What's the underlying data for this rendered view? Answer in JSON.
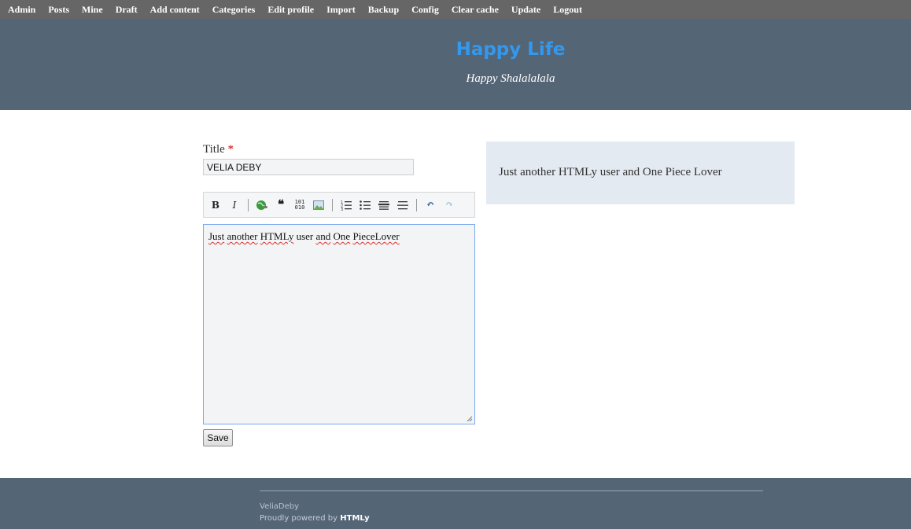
{
  "admin_bar": {
    "items": [
      "Admin",
      "Posts",
      "Mine",
      "Draft",
      "Add content",
      "Categories",
      "Edit profile",
      "Import",
      "Backup",
      "Config",
      "Clear cache",
      "Update",
      "Logout"
    ]
  },
  "header": {
    "site_title": "Happy Life",
    "tagline": "Happy Shalalalala",
    "background_color": "#546576",
    "title_color": "#3399ee"
  },
  "form": {
    "title_label": "Title",
    "required_marker": "*",
    "title_value": "VELIA DEBY",
    "editor_toolbar": [
      {
        "icon": "bold-icon",
        "glyph": "B"
      },
      {
        "icon": "italic-icon",
        "glyph": "I"
      },
      {
        "icon": "link-icon"
      },
      {
        "icon": "quote-icon",
        "glyph": "❝"
      },
      {
        "icon": "code-icon",
        "glyph": "101"
      },
      {
        "icon": "image-icon"
      },
      {
        "icon": "ordered-list-icon"
      },
      {
        "icon": "unordered-list-icon"
      },
      {
        "icon": "heading-icon"
      },
      {
        "icon": "horizontal-rule-icon"
      },
      {
        "icon": "undo-icon",
        "glyph": "↶"
      },
      {
        "icon": "redo-icon",
        "glyph": "↷"
      }
    ],
    "content": {
      "words": [
        "Just",
        "another",
        "HTMLy",
        "user",
        "and",
        "One",
        "Piece",
        "Lover"
      ]
    },
    "save_label": "Save"
  },
  "preview": {
    "text": "Just another HTMLy user and One Piece Lover"
  },
  "footer": {
    "author": "VeliaDeby",
    "powered_prefix": "Proudly powered by",
    "powered_brand": "HTMLy"
  }
}
